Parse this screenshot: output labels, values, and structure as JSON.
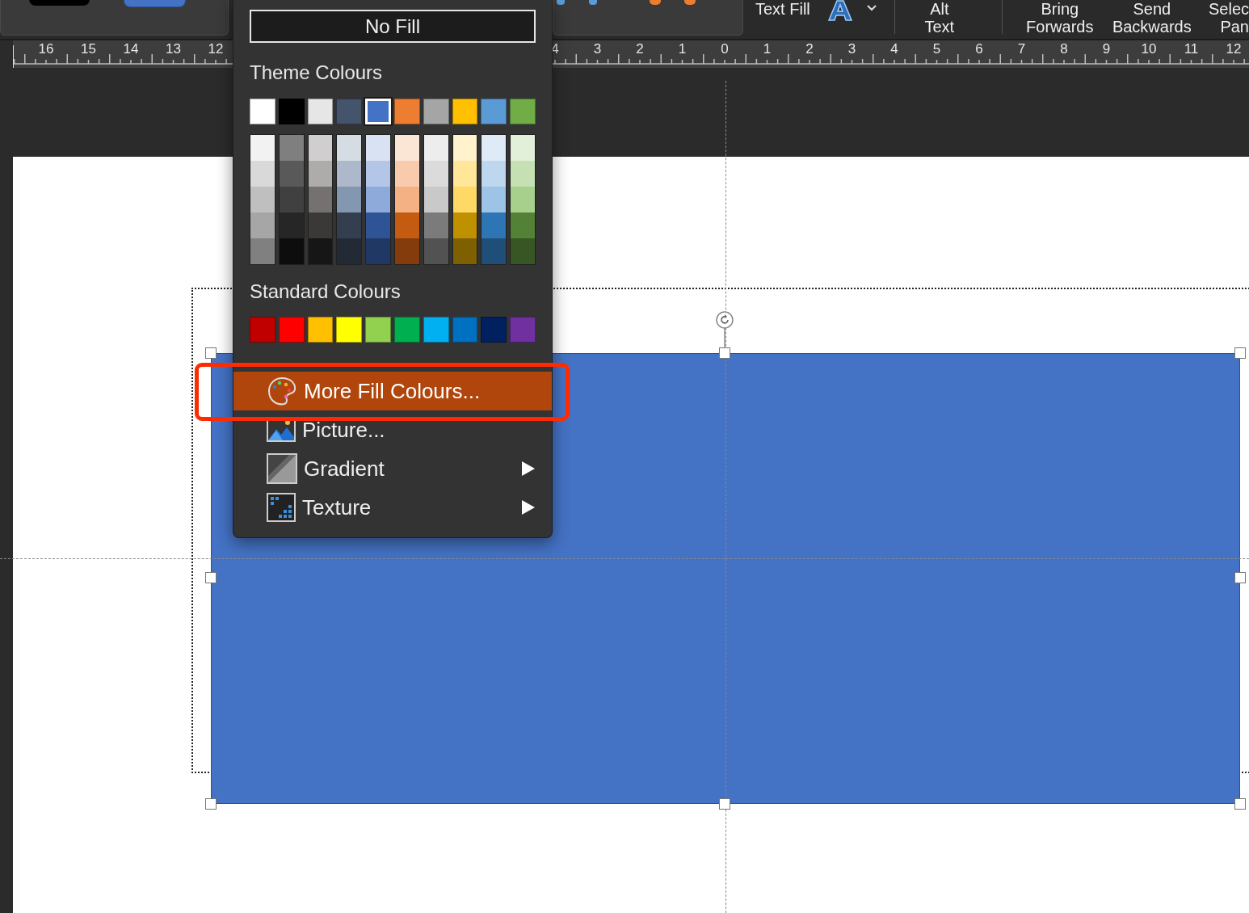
{
  "toolbar": {
    "text_fill_label": "Text Fill",
    "buttons": [
      {
        "line_1": "Alt",
        "line_2": "Text"
      },
      {
        "line_1": "Bring",
        "line_2": "Forwards"
      },
      {
        "line_1": "Send",
        "line_2": "Backwards"
      },
      {
        "line_1": "Selec",
        "line_2": "Pan"
      }
    ]
  },
  "ruler": {
    "left_labels": [
      "16",
      "15",
      "14",
      "13",
      "12"
    ],
    "right_labels": [
      "4",
      "3",
      "2",
      "1",
      "0",
      "1",
      "2",
      "3",
      "4",
      "5",
      "6",
      "7",
      "8",
      "9",
      "10",
      "11",
      "12"
    ]
  },
  "fill_menu": {
    "no_fill": "No Fill",
    "theme_title": "Theme Colours",
    "theme_colours": [
      {
        "color": "#ffffff",
        "selected": false
      },
      {
        "color": "#000000",
        "selected": false
      },
      {
        "color": "#e7e6e6",
        "selected": false
      },
      {
        "color": "#44546a",
        "selected": false
      },
      {
        "color": "#4472c4",
        "selected": true
      },
      {
        "color": "#ed7d31",
        "selected": false
      },
      {
        "color": "#a5a5a5",
        "selected": false
      },
      {
        "color": "#ffc000",
        "selected": false
      },
      {
        "color": "#5b9bd5",
        "selected": false
      },
      {
        "color": "#70ad47",
        "selected": false
      }
    ],
    "shade_columns": [
      {
        "shades": [
          {
            "color": "#f2f2f2"
          },
          {
            "color": "#d9d9d9"
          },
          {
            "color": "#bfbfbf"
          },
          {
            "color": "#a6a6a6"
          },
          {
            "color": "#808080"
          }
        ]
      },
      {
        "shades": [
          {
            "color": "#7f7f7f"
          },
          {
            "color": "#595959"
          },
          {
            "color": "#404040"
          },
          {
            "color": "#262626"
          },
          {
            "color": "#0d0d0d"
          }
        ]
      },
      {
        "shades": [
          {
            "color": "#d0cece"
          },
          {
            "color": "#aeabab"
          },
          {
            "color": "#767171"
          },
          {
            "color": "#3b3838"
          },
          {
            "color": "#171616"
          }
        ]
      },
      {
        "shades": [
          {
            "color": "#d6dce4"
          },
          {
            "color": "#adb9ca"
          },
          {
            "color": "#8497b0"
          },
          {
            "color": "#333f4f"
          },
          {
            "color": "#222a35"
          }
        ]
      },
      {
        "shades": [
          {
            "color": "#d9e2f3"
          },
          {
            "color": "#b4c6e7"
          },
          {
            "color": "#8eaadb"
          },
          {
            "color": "#2f5496"
          },
          {
            "color": "#1f3864"
          }
        ]
      },
      {
        "shades": [
          {
            "color": "#fbe5d5"
          },
          {
            "color": "#f8cbad"
          },
          {
            "color": "#f4b183"
          },
          {
            "color": "#c55a11"
          },
          {
            "color": "#843c0c"
          }
        ]
      },
      {
        "shades": [
          {
            "color": "#ededed"
          },
          {
            "color": "#dbdbdb"
          },
          {
            "color": "#c9c9c9"
          },
          {
            "color": "#7b7b7b"
          },
          {
            "color": "#525252"
          }
        ]
      },
      {
        "shades": [
          {
            "color": "#fff2cc"
          },
          {
            "color": "#ffe699"
          },
          {
            "color": "#ffd966"
          },
          {
            "color": "#bf9000"
          },
          {
            "color": "#7f6000"
          }
        ]
      },
      {
        "shades": [
          {
            "color": "#deebf6"
          },
          {
            "color": "#bdd7ee"
          },
          {
            "color": "#9dc3e6"
          },
          {
            "color": "#2e75b5"
          },
          {
            "color": "#1f4e79"
          }
        ]
      },
      {
        "shades": [
          {
            "color": "#e2efd9"
          },
          {
            "color": "#c5e0b3"
          },
          {
            "color": "#a8d08d"
          },
          {
            "color": "#538135"
          },
          {
            "color": "#375623"
          }
        ]
      }
    ],
    "standard_title": "Standard Colours",
    "standard_colours": [
      {
        "color": "#c00000"
      },
      {
        "color": "#ff0000"
      },
      {
        "color": "#ffc000"
      },
      {
        "color": "#ffff00"
      },
      {
        "color": "#92d050"
      },
      {
        "color": "#00b050"
      },
      {
        "color": "#00b0f0"
      },
      {
        "color": "#0070c0"
      },
      {
        "color": "#002060"
      },
      {
        "color": "#7030a0"
      }
    ],
    "items": [
      {
        "label": "More Fill Colours...",
        "kind": "palette",
        "selected": true,
        "submenu": false
      },
      {
        "label": "Picture...",
        "kind": "picture",
        "selected": false,
        "submenu": false
      },
      {
        "label": "Gradient",
        "kind": "gradient",
        "selected": false,
        "submenu": true
      },
      {
        "label": "Texture",
        "kind": "texture",
        "selected": false,
        "submenu": true
      }
    ]
  }
}
